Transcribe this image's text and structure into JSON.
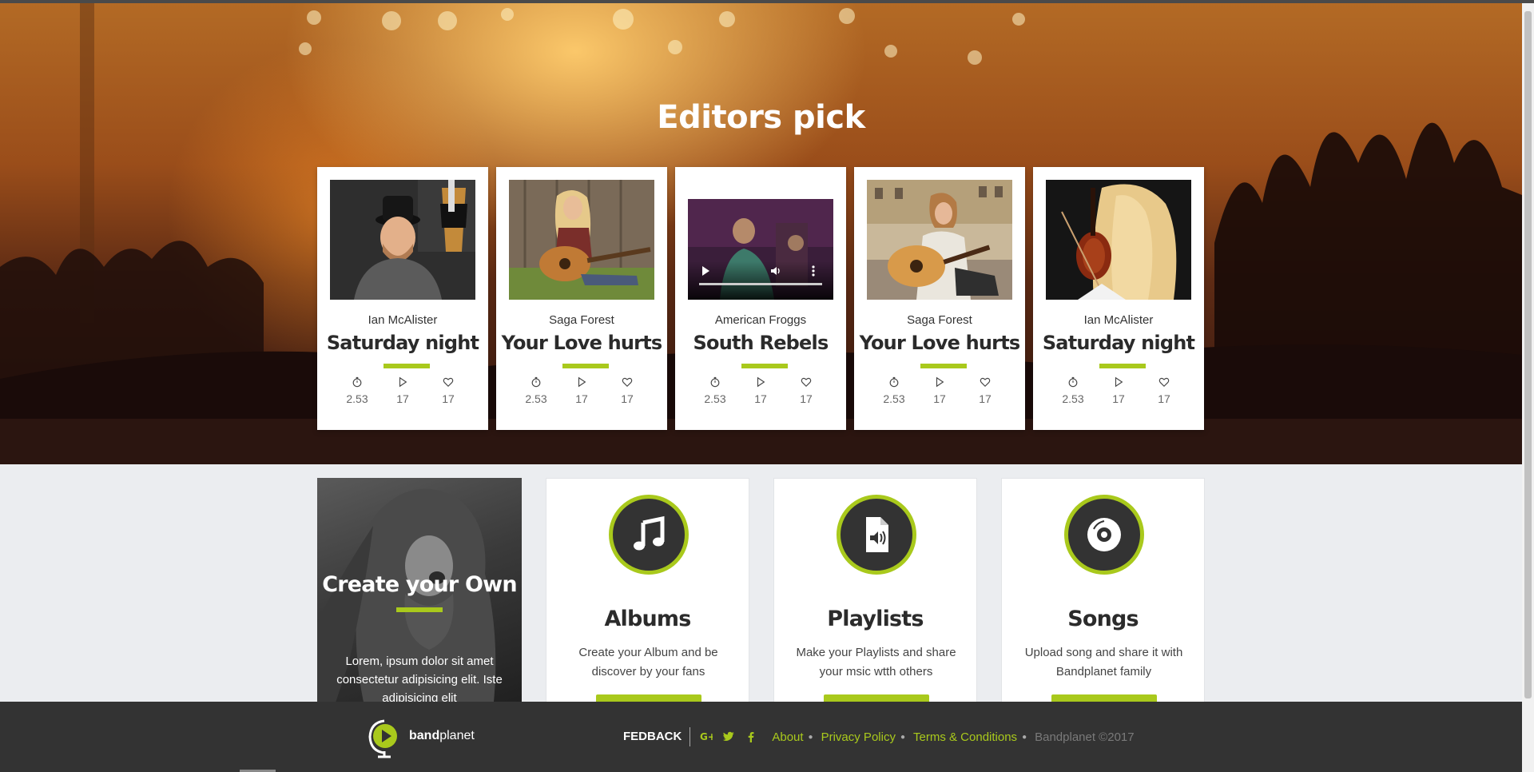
{
  "hero": {
    "title": "Editors pick",
    "cards": [
      {
        "artist": "Ian McAlister",
        "song": "Saturday night",
        "duration": "2.53",
        "plays": "17",
        "likes": "17",
        "media": "photo"
      },
      {
        "artist": "Saga Forest",
        "song": "Your Love hurts",
        "duration": "2.53",
        "plays": "17",
        "likes": "17",
        "media": "photo"
      },
      {
        "artist": "American Froggs",
        "song": "South Rebels",
        "duration": "2.53",
        "plays": "17",
        "likes": "17",
        "media": "video"
      },
      {
        "artist": "Saga Forest",
        "song": "Your Love hurts",
        "duration": "2.53",
        "plays": "17",
        "likes": "17",
        "media": "photo"
      },
      {
        "artist": "Ian McAlister",
        "song": "Saturday night",
        "duration": "2.53",
        "plays": "17",
        "likes": "17",
        "media": "photo"
      }
    ]
  },
  "create": {
    "title": "Create your Own",
    "text": "Lorem, ipsum dolor sit amet consectetur adipisicing elit. Iste adipisicing elit"
  },
  "features": [
    {
      "title": "Albums",
      "desc": "Create your Album and be discover by your fans",
      "icon": "music-note-icon"
    },
    {
      "title": "Playlists",
      "desc": "Make your Playlists and share your msic wtth others",
      "icon": "audio-file-icon"
    },
    {
      "title": "Songs",
      "desc": "Upload song and share it with Bandplanet family",
      "icon": "disc-icon"
    }
  ],
  "footer": {
    "brand_bold": "band",
    "brand_rest": "planet",
    "fedback": "FEDBACK",
    "links": [
      "About",
      "Privacy Policy",
      "Terms & Conditions"
    ],
    "copyright": "Bandplanet ©2017"
  },
  "colors": {
    "accent": "#a9c91c",
    "dark": "#333333"
  }
}
